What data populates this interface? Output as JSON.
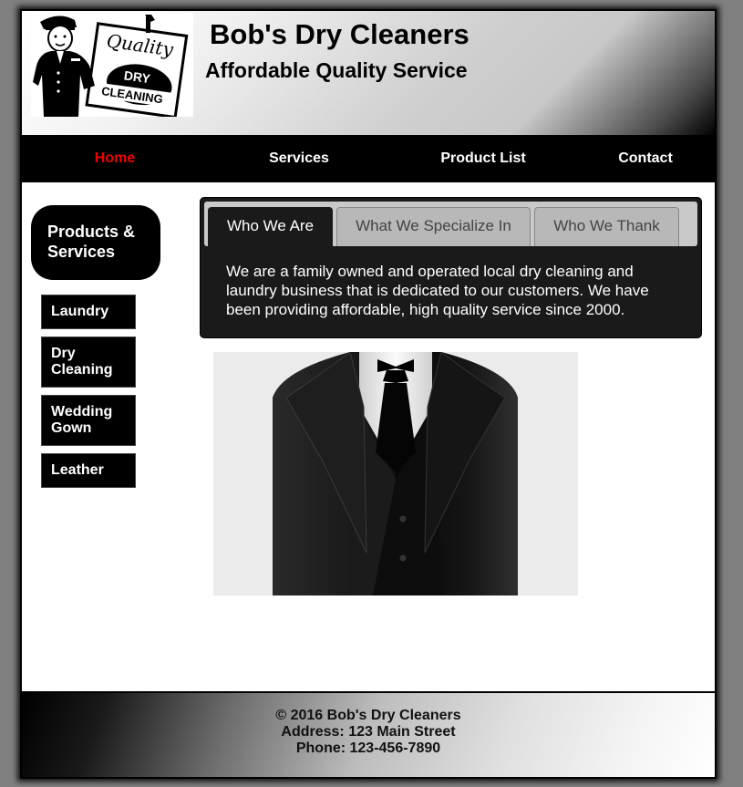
{
  "header": {
    "title": "Bob's Dry Cleaners",
    "tagline": "Affordable Quality Service",
    "logo": {
      "name": "quality-dry-cleaning-logo",
      "sign_text_script": "Quality",
      "sign_text_oval_top": "DRY",
      "sign_text_oval_bottom": "CLEANING"
    }
  },
  "nav": {
    "items": [
      {
        "label": "Home",
        "active": true
      },
      {
        "label": "Services",
        "active": false
      },
      {
        "label": "Product List",
        "active": false
      },
      {
        "label": "Contact",
        "active": false
      }
    ],
    "active_color": "#ee0000"
  },
  "sidebar": {
    "heading": "Products & Services",
    "items": [
      {
        "label": "Laundry"
      },
      {
        "label": "Dry Cleaning"
      },
      {
        "label": "Wedding Gown"
      },
      {
        "label": "Leather"
      }
    ]
  },
  "tabs": {
    "items": [
      {
        "label": "Who We Are",
        "active": true
      },
      {
        "label": "What We Specialize In",
        "active": false
      },
      {
        "label": "Who We Thank",
        "active": false
      }
    ],
    "content": "We are a family owned and operated local dry cleaning and laundry business that is dedicated to our customers. We have been providing affordable, high quality service since 2000."
  },
  "main_image": {
    "name": "black-tuxedo-suit-image"
  },
  "footer": {
    "copyright": "© 2016 Bob's Dry Cleaners",
    "address": "Address: 123 Main Street",
    "phone": "Phone: 123-456-7890"
  }
}
